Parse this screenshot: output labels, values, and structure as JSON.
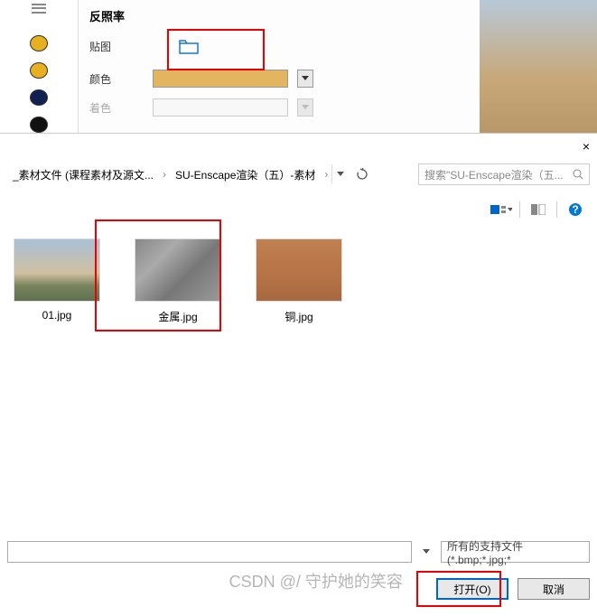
{
  "panel": {
    "section_title": "反照率",
    "texture_label": "贴图",
    "color_label": "颜色",
    "tint_label": "着色",
    "swatch_color": "#e4b560",
    "dots": [
      "#e8b020",
      "#e8b020",
      "#102050",
      "#111111"
    ]
  },
  "dialog": {
    "close": "×",
    "path_segments": [
      "_素材文件 (课程素材及源文...",
      "SU-Enscape渲染（五）-素材"
    ],
    "path_arrow": "›",
    "search_placeholder": "搜索\"SU-Enscape渲染（五...",
    "files": [
      {
        "name": "01.jpg",
        "thumb": "sky"
      },
      {
        "name": "金属.jpg",
        "thumb": "metal"
      },
      {
        "name": "铜.jpg",
        "thumb": "copper"
      }
    ],
    "filetype": "所有的支持文件 (*.bmp;*.jpg;*",
    "open_label": "打开(O)",
    "cancel_label": "取消"
  },
  "watermark": "CSDN @/ 守护她的笑容"
}
